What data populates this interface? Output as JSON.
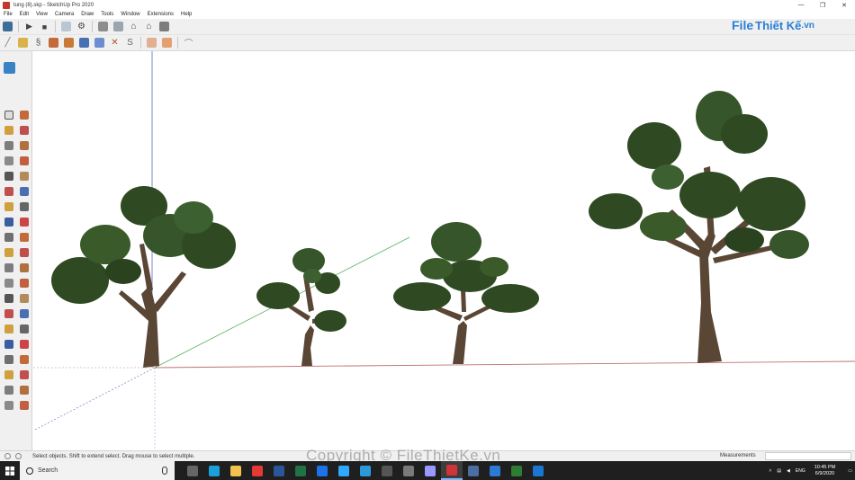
{
  "window": {
    "title": "tung (8).skp - SketchUp Pro 2020",
    "controls": [
      "—",
      "❐",
      "✕"
    ]
  },
  "menu": [
    "File",
    "Edit",
    "View",
    "Camera",
    "Draw",
    "Tools",
    "Window",
    "Extensions",
    "Help"
  ],
  "toolbar_row1": [
    "sketchup-logo-icon",
    "play-icon",
    "stop-icon",
    "layer-icon",
    "gear-icon",
    "component-icon",
    "warehouse-icon",
    "home-icon",
    "house-outline-icon",
    "stack-icon"
  ],
  "toolbar_row2": [
    "pencil-line-icon",
    "select-move-icon",
    "spiral-icon",
    "cut-icon",
    "box-icon",
    "paint-icon",
    "orbit-icon",
    "cross-tool-icon",
    "curve-icon",
    "frame-icon",
    "frame-move-icon",
    "arc-icon"
  ],
  "logo": {
    "part1": "File",
    "part2": "Thiết Kế",
    "part3": ".vn"
  },
  "left_tools": [
    "select-icon",
    "eraser-icon",
    "paint-bucket-icon",
    "eraser-soft-icon",
    "line-icon",
    "freehand-icon",
    "rectangle-icon",
    "rotated-rect-icon",
    "circle-icon",
    "polygon-icon",
    "arc-icon",
    "arc-2-icon",
    "pie-icon",
    "arc-3-icon",
    "move-icon",
    "push-pull-icon",
    "rotate-icon",
    "follow-me-icon",
    "scale-icon",
    "offset-icon",
    "tape-icon",
    "dimension-icon",
    "protractor-icon",
    "text-icon",
    "axes-icon",
    "3d-text-icon",
    "orbit-icon",
    "pan-icon",
    "zoom-icon",
    "zoom-window-icon",
    "zoom-extents-icon",
    "search-icon",
    "walk-icon",
    "look-around-icon",
    "footprint-icon",
    "position-camera-icon",
    "section-plane-icon",
    "section-display-icon",
    "red-tool-icon",
    "red-tool-2-icon"
  ],
  "colors": {
    "green_axis": "#4caf50",
    "red_axis": "#c0392b",
    "blue_axis": "#3f51b5",
    "foliage": "#2f4a22",
    "trunk": "#5a4634"
  },
  "status": {
    "hint": "Select objects. Shift to extend select. Drag mouse to select multiple.",
    "measurements_label": "Measurements",
    "measurements_value": ""
  },
  "watermark": "Copyright © FileThietKe.vn",
  "taskbar": {
    "search_placeholder": "Search",
    "apps": [
      "task-view-icon",
      "store-icon",
      "file-explorer-icon",
      "opera-icon",
      "word-icon",
      "excel-icon",
      "chrome-icon",
      "photoshop-icon",
      "photos-icon",
      "calculator-icon",
      "camera-icon",
      "after-effects-icon",
      "sketchup-icon",
      "gallery-icon",
      "vscode-icon",
      "app-green-icon",
      "app-blue-icon"
    ],
    "lang": "ENG",
    "time": "10:45 PM",
    "date": "6/9/2020"
  }
}
